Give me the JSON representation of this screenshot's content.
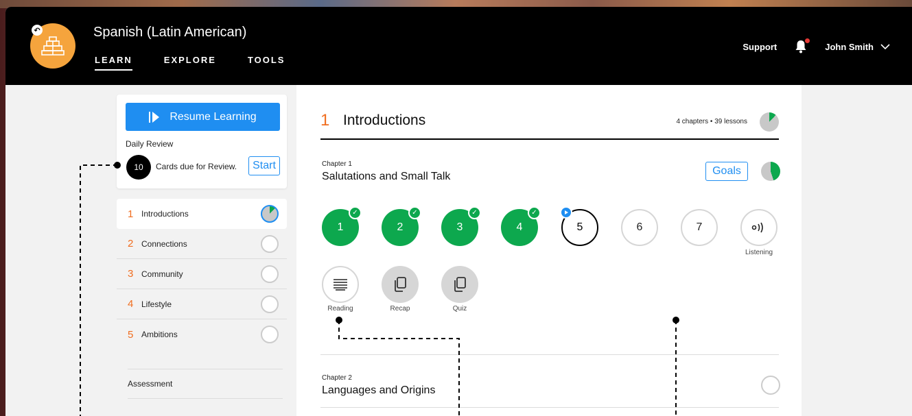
{
  "header": {
    "course_title": "Spanish (Latin American)",
    "tabs": [
      {
        "label": "LEARN",
        "active": true
      },
      {
        "label": "EXPLORE",
        "active": false
      },
      {
        "label": "TOOLS",
        "active": false
      }
    ],
    "support_label": "Support",
    "user_name": "John Smith"
  },
  "sidebar": {
    "resume_label": "Resume Learning",
    "daily_review_label": "Daily Review",
    "review_count": "10",
    "review_text": "Cards due for Review.",
    "start_label": "Start",
    "units": [
      {
        "num": "1",
        "label": "Introductions",
        "active": true
      },
      {
        "num": "2",
        "label": "Connections",
        "active": false
      },
      {
        "num": "3",
        "label": "Community",
        "active": false
      },
      {
        "num": "4",
        "label": "Lifestyle",
        "active": false
      },
      {
        "num": "5",
        "label": "Ambitions",
        "active": false
      }
    ],
    "assessment_label": "Assessment"
  },
  "main": {
    "unit_num": "1",
    "unit_title": "Introductions",
    "unit_meta": "4 chapters • 39 lessons",
    "unit_progress": 0.12,
    "chapters": [
      {
        "label": "Chapter 1",
        "title": "Salutations and Small Talk",
        "goals_label": "Goals",
        "progress": 0.45,
        "lessons": [
          "1",
          "2",
          "3",
          "4",
          "5",
          "6",
          "7"
        ],
        "lesson_states": [
          "done",
          "done",
          "done",
          "done",
          "current",
          "todo",
          "todo"
        ],
        "extras": [
          {
            "caption": "Listening",
            "icon": "listening-icon"
          },
          {
            "caption": "Reading",
            "icon": "reading-icon"
          },
          {
            "caption": "Recap",
            "icon": "recap-icon"
          },
          {
            "caption": "Quiz",
            "icon": "quiz-icon"
          }
        ]
      },
      {
        "label": "Chapter 2",
        "title": "Languages and Origins",
        "progress": 0
      }
    ]
  },
  "colors": {
    "accent_blue": "#1f8ef1",
    "complete_green": "#0da84e",
    "unit_orange": "#f06d1f",
    "logo_orange": "#f5a43d"
  }
}
